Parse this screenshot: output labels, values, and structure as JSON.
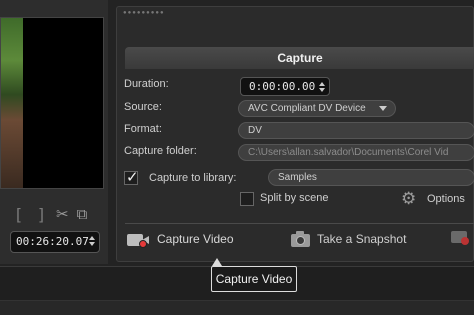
{
  "preview": {
    "timecode": "00:26:20.07",
    "mark_in": "[",
    "mark_out": "]"
  },
  "capture": {
    "title": "Capture",
    "duration": {
      "label": "Duration:",
      "value": "0:00:00.00"
    },
    "source": {
      "label": "Source:",
      "value": "AVC Compliant DV Device"
    },
    "format": {
      "label": "Format:",
      "value": "DV"
    },
    "capture_folder": {
      "label": "Capture folder:",
      "value": "C:\\Users\\allan.salvador\\Documents\\Corel Vid"
    },
    "capture_to_library": {
      "label": "Capture to library:",
      "checked": true,
      "value": "Samples"
    },
    "split_by_scene": {
      "label": "Split by scene",
      "checked": false
    },
    "options_label": "Options",
    "actions": {
      "capture_video": "Capture Video",
      "take_snapshot": "Take a Snapshot"
    }
  },
  "tooltip": {
    "text": "Capture Video"
  }
}
